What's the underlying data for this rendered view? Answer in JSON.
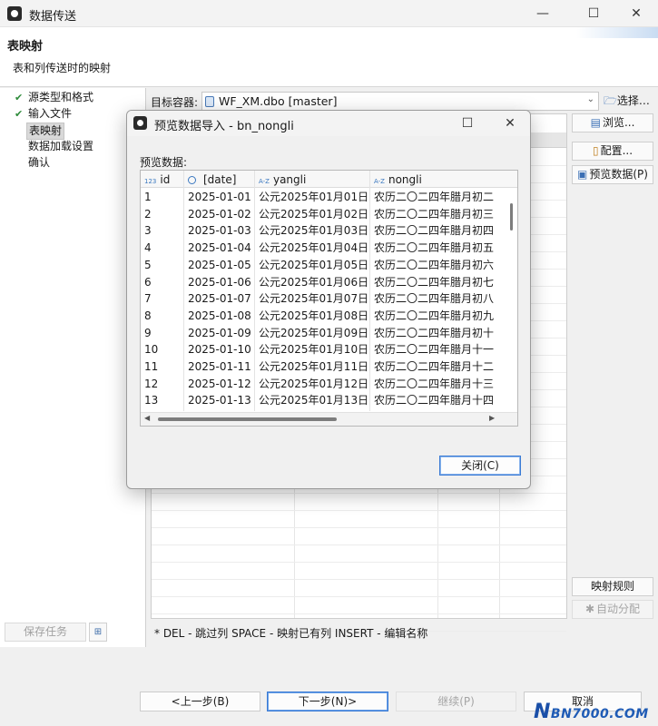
{
  "window": {
    "title": "数据传送",
    "minimize": "—",
    "maximize": "☐",
    "close": "✕"
  },
  "header": {
    "title": "表映射",
    "subtitle": "表和列传送时的映射"
  },
  "steps": [
    {
      "label": "源类型和格式",
      "done": true
    },
    {
      "label": "输入文件",
      "done": true
    },
    {
      "label": "表映射",
      "done": false,
      "active": true
    },
    {
      "label": "数据加载设置",
      "done": false
    },
    {
      "label": "确认",
      "done": false
    }
  ],
  "check_glyph": "✔",
  "left_footer": {
    "save_task": "保存任务",
    "icon_glyph": "⊞"
  },
  "target": {
    "label": "目标容器:",
    "value": "WF_XM.dbo  [master]",
    "arrow": "⌄",
    "choose": "选择…"
  },
  "right_buttons": {
    "browse": "浏览...",
    "config": "配置...",
    "preview": "预览数据(P)",
    "mapping_rules": "映射规则",
    "auto_assign": "自动分配"
  },
  "hint": "* DEL - 跳过列  SPACE - 映射已有列  INSERT - 编辑名称",
  "bottom": {
    "prev": "<上一步(B)",
    "next": "下一步(N)>",
    "continue": "继续(P)",
    "cancel": "取消"
  },
  "watermark": {
    "n": "N",
    "rest": "BN7000.COM"
  },
  "dialog": {
    "title": "预览数据导入 - bn_nongli",
    "maximize": "☐",
    "close": "✕",
    "preview_label": "预览数据:",
    "close_button": "关闭(C)",
    "columns": [
      {
        "name": "id",
        "type_icon": "123"
      },
      {
        "name": "[date]",
        "type_icon": "clock"
      },
      {
        "name": "yangli",
        "type_icon": "A-Z"
      },
      {
        "name": "nongli",
        "type_icon": "A-Z"
      }
    ],
    "rows": [
      [
        "1",
        "2025-01-01",
        "公元2025年01月01日",
        "农历二〇二四年腊月初二"
      ],
      [
        "2",
        "2025-01-02",
        "公元2025年01月02日",
        "农历二〇二四年腊月初三"
      ],
      [
        "3",
        "2025-01-03",
        "公元2025年01月03日",
        "农历二〇二四年腊月初四"
      ],
      [
        "4",
        "2025-01-04",
        "公元2025年01月04日",
        "农历二〇二四年腊月初五"
      ],
      [
        "5",
        "2025-01-05",
        "公元2025年01月05日",
        "农历二〇二四年腊月初六"
      ],
      [
        "6",
        "2025-01-06",
        "公元2025年01月06日",
        "农历二〇二四年腊月初七"
      ],
      [
        "7",
        "2025-01-07",
        "公元2025年01月07日",
        "农历二〇二四年腊月初八"
      ],
      [
        "8",
        "2025-01-08",
        "公元2025年01月08日",
        "农历二〇二四年腊月初九"
      ],
      [
        "9",
        "2025-01-09",
        "公元2025年01月09日",
        "农历二〇二四年腊月初十"
      ],
      [
        "10",
        "2025-01-10",
        "公元2025年01月10日",
        "农历二〇二四年腊月十一"
      ],
      [
        "11",
        "2025-01-11",
        "公元2025年01月11日",
        "农历二〇二四年腊月十二"
      ],
      [
        "12",
        "2025-01-12",
        "公元2025年01月12日",
        "农历二〇二四年腊月十三"
      ],
      [
        "13",
        "2025-01-13",
        "公元2025年01月13日",
        "农历二〇二四年腊月十四"
      ]
    ]
  }
}
